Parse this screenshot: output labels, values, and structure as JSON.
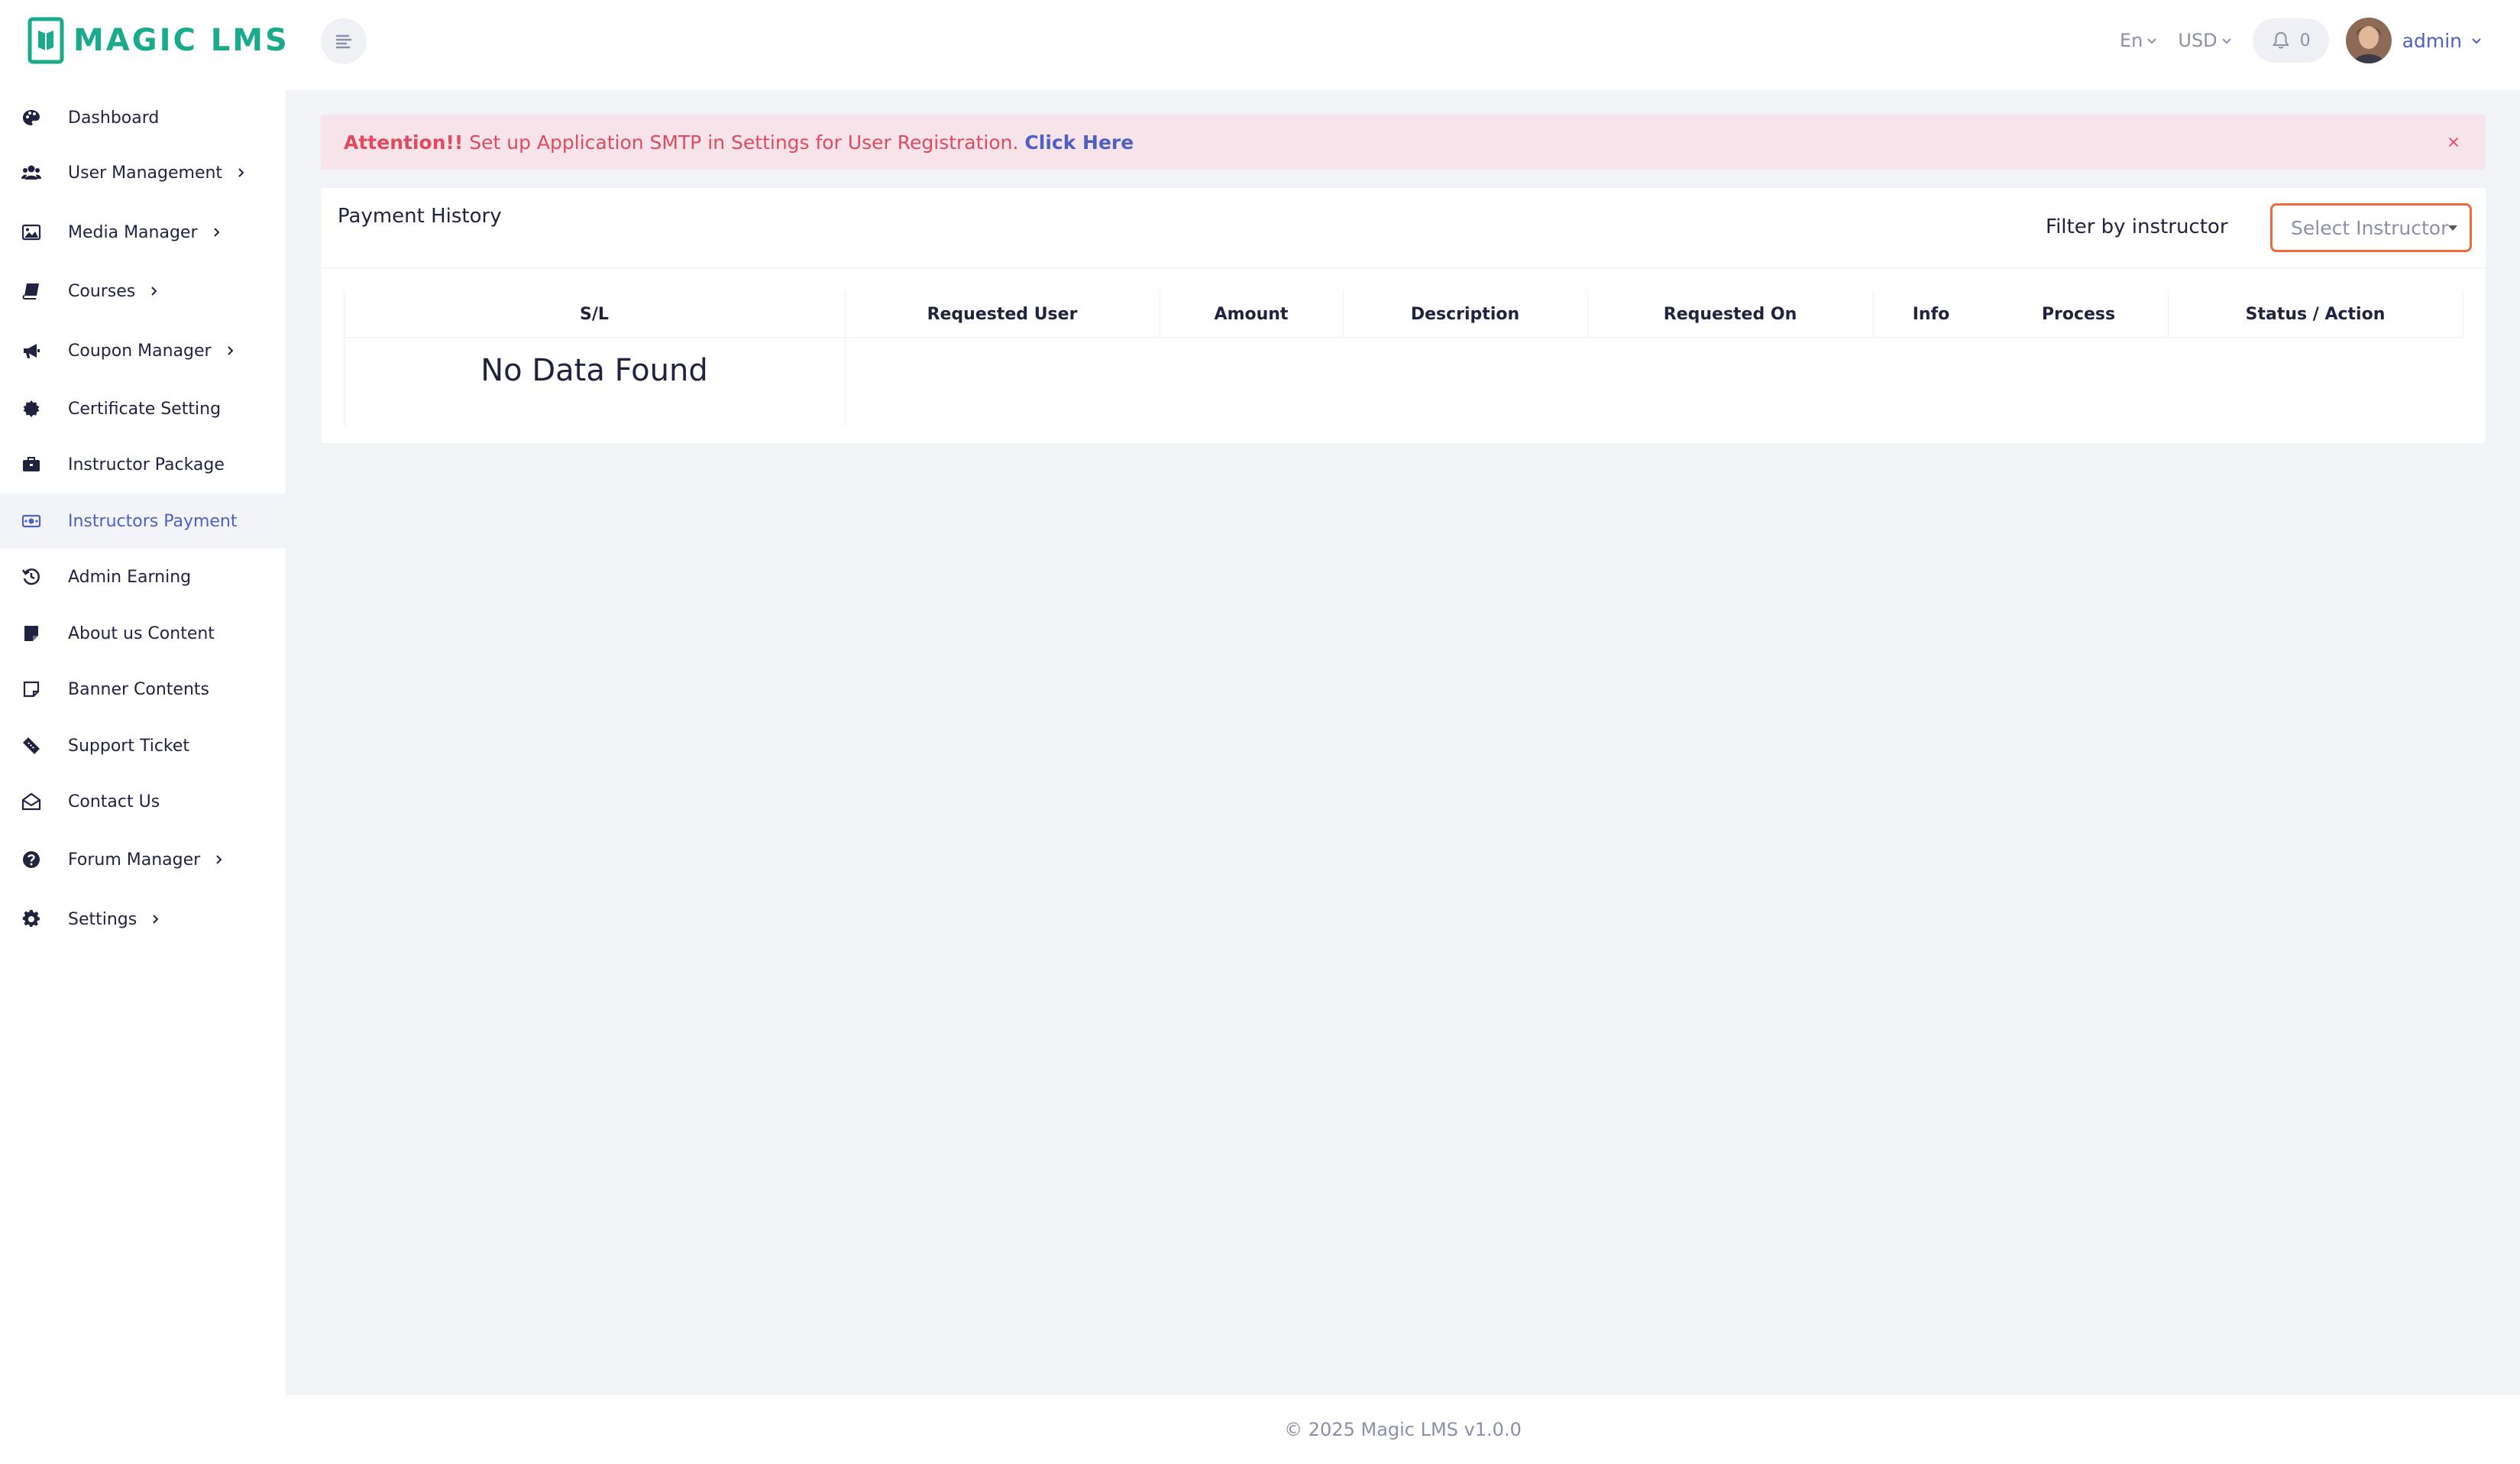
{
  "brand": {
    "name": "MAGIC LMS",
    "color": "#1aaa8c"
  },
  "header": {
    "language": "En",
    "currency": "USD",
    "notification_count": "0",
    "user_name": "admin"
  },
  "sidebar": {
    "active_color": "#4f5fc4",
    "items": [
      {
        "label": "Dashboard",
        "icon": "palette-icon",
        "has_arrow": false
      },
      {
        "label": "User Management",
        "icon": "users-icon",
        "has_arrow": true
      },
      {
        "label": "Media Manager",
        "icon": "image-icon",
        "has_arrow": true
      },
      {
        "label": "Courses",
        "icon": "book-icon",
        "has_arrow": true
      },
      {
        "label": "Coupon Manager",
        "icon": "megaphone-icon",
        "has_arrow": true
      },
      {
        "label": "Certificate Setting",
        "icon": "certificate-icon",
        "has_arrow": false
      },
      {
        "label": "Instructor Package",
        "icon": "briefcase-icon",
        "has_arrow": false
      },
      {
        "label": "Instructors Payment",
        "icon": "money-icon",
        "has_arrow": false,
        "active": true
      },
      {
        "label": "Admin Earning",
        "icon": "history-icon",
        "has_arrow": false
      },
      {
        "label": "About us Content",
        "icon": "note-icon",
        "has_arrow": false
      },
      {
        "label": "Banner Contents",
        "icon": "sticky-note-icon",
        "has_arrow": false
      },
      {
        "label": "Support Ticket",
        "icon": "ticket-icon",
        "has_arrow": false
      },
      {
        "label": "Contact Us",
        "icon": "envelope-open-icon",
        "has_arrow": false
      },
      {
        "label": "Forum Manager",
        "icon": "question-circle-icon",
        "has_arrow": true
      },
      {
        "label": "Settings",
        "icon": "gear-icon",
        "has_arrow": true
      }
    ]
  },
  "alert": {
    "strong": "Attention!!",
    "message": " Set up Application SMTP in Settings for User Registration. ",
    "link": "Click Here",
    "color": "#e04a5f"
  },
  "card": {
    "title": "Payment History",
    "filter_label": "Filter by instructor",
    "select_placeholder": "Select Instructor",
    "columns": [
      "S/L",
      "Requested User",
      "Amount",
      "Description",
      "Requested On",
      "Info",
      "Process",
      "Status / Action"
    ],
    "empty_message": "No Data Found"
  },
  "footer": {
    "text": "© 2025 Magic LMS v1.0.0"
  }
}
